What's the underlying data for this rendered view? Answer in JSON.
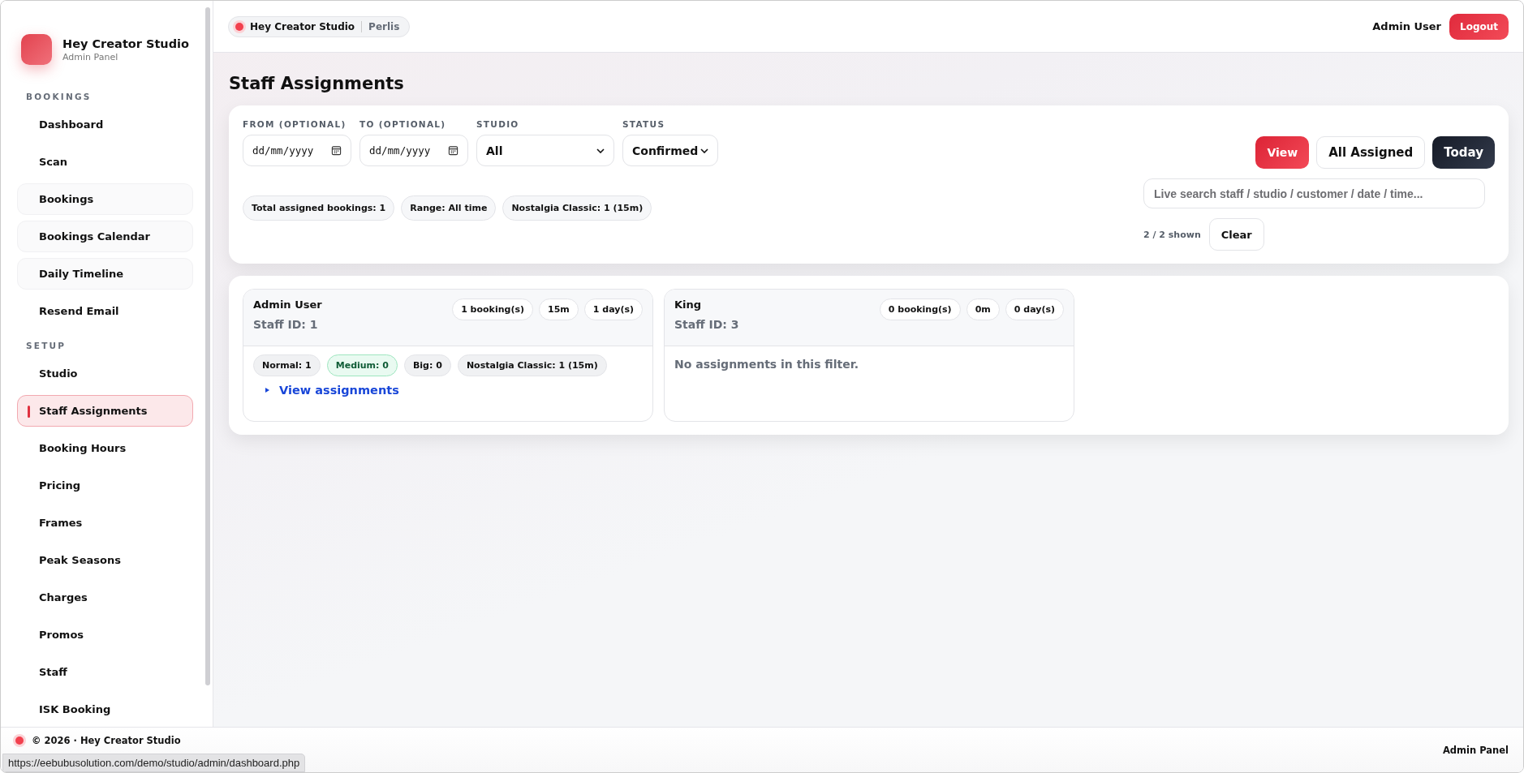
{
  "brand": {
    "title": "Hey Creator Studio",
    "subtitle": "Admin Panel"
  },
  "sidebar": {
    "sections": [
      {
        "heading": "BOOKINGS",
        "items": [
          {
            "label": "Dashboard",
            "selected": false,
            "shaded": false
          },
          {
            "label": "Scan",
            "selected": false,
            "shaded": false
          },
          {
            "label": "Bookings",
            "selected": false,
            "shaded": true
          },
          {
            "label": "Bookings Calendar",
            "selected": false,
            "shaded": true
          },
          {
            "label": "Daily Timeline",
            "selected": false,
            "shaded": true
          },
          {
            "label": "Resend Email",
            "selected": false,
            "shaded": false
          }
        ]
      },
      {
        "heading": "SETUP",
        "items": [
          {
            "label": "Studio",
            "selected": false,
            "shaded": false
          },
          {
            "label": "Staff Assignments",
            "selected": true,
            "shaded": false
          },
          {
            "label": "Booking Hours",
            "selected": false,
            "shaded": false
          },
          {
            "label": "Pricing",
            "selected": false,
            "shaded": false
          },
          {
            "label": "Frames",
            "selected": false,
            "shaded": false
          },
          {
            "label": "Peak Seasons",
            "selected": false,
            "shaded": false
          },
          {
            "label": "Charges",
            "selected": false,
            "shaded": false
          },
          {
            "label": "Promos",
            "selected": false,
            "shaded": false
          },
          {
            "label": "Staff",
            "selected": false,
            "shaded": false
          },
          {
            "label": "ISK Booking",
            "selected": false,
            "shaded": false
          }
        ]
      }
    ]
  },
  "topbar": {
    "studio": "Hey Creator Studio",
    "location": "Perlis",
    "user": "Admin User",
    "logout": "Logout"
  },
  "page_title": "Staff Assignments",
  "filters": {
    "fields": [
      {
        "kind": "date",
        "label": "FROM (OPTIONAL)",
        "placeholder": "dd/mm/yyyy"
      },
      {
        "kind": "date",
        "label": "TO (OPTIONAL)",
        "placeholder": "dd/mm/yyyy"
      },
      {
        "kind": "select",
        "label": "STUDIO",
        "value": "All"
      },
      {
        "kind": "select",
        "label": "STATUS",
        "value": "Confirmed"
      }
    ],
    "buttons": [
      {
        "label": "View",
        "kind": "primary"
      },
      {
        "label": "All Assigned",
        "kind": "outline"
      },
      {
        "label": "Today",
        "kind": "dark"
      }
    ],
    "summary": [
      "Total assigned bookings: 1",
      "Range: All time",
      "Nostalgia Classic: 1 (15m)"
    ],
    "search": {
      "placeholder": "Live search staff / studio / customer / date / time..."
    },
    "shown": "2 / 2 shown",
    "clear": "Clear"
  },
  "staff": [
    {
      "name": "Admin User",
      "staff_id": "Staff ID: 1",
      "stats": [
        "1 booking(s)",
        "15m",
        "1 day(s)"
      ],
      "chips": [
        {
          "label": "Normal: 1",
          "highlighted": false
        },
        {
          "label": "Medium: 0",
          "highlighted": true
        },
        {
          "label": "Big: 0",
          "highlighted": false
        },
        {
          "label": "Nostalgia Classic: 1 (15m)",
          "highlighted": false
        }
      ],
      "link": "View assignments"
    },
    {
      "name": "King",
      "staff_id": "Staff ID: 3",
      "stats": [
        "0 booking(s)",
        "0m",
        "0 day(s)"
      ],
      "empty": "No assignments in this filter."
    }
  ],
  "footer": {
    "copyright": "© 2026 · Hey Creator Studio",
    "right": "Admin Panel"
  },
  "status_url": "https://eebubusolution.com/demo/studio/admin/dashboard.php"
}
